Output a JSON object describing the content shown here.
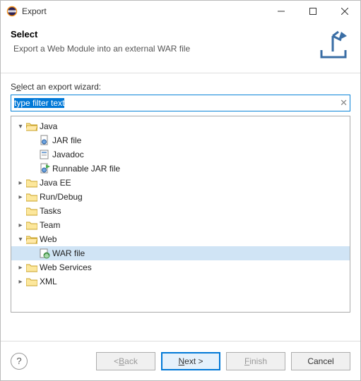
{
  "window": {
    "title": "Export"
  },
  "header": {
    "title": "Select",
    "subtitle": "Export a Web Module into an external WAR file"
  },
  "filter": {
    "label_pre": "S",
    "label_hot": "e",
    "label_post": "lect an export wizard:",
    "value": "type filter text",
    "clear_symbol": "✕"
  },
  "tree": {
    "java": {
      "label": "Java",
      "jar": "JAR file",
      "javadoc": "Javadoc",
      "runnable": "Runnable JAR file"
    },
    "javaee": "Java EE",
    "rundebug": "Run/Debug",
    "tasks": "Tasks",
    "team": "Team",
    "web": {
      "label": "Web",
      "war": "WAR file"
    },
    "webservices": "Web Services",
    "xml": "XML"
  },
  "buttons": {
    "back_pre": "< ",
    "back_hot": "B",
    "back_post": "ack",
    "next_hot": "N",
    "next_post": "ext >",
    "finish_hot": "F",
    "finish_post": "inish",
    "cancel": "Cancel",
    "help": "?"
  }
}
